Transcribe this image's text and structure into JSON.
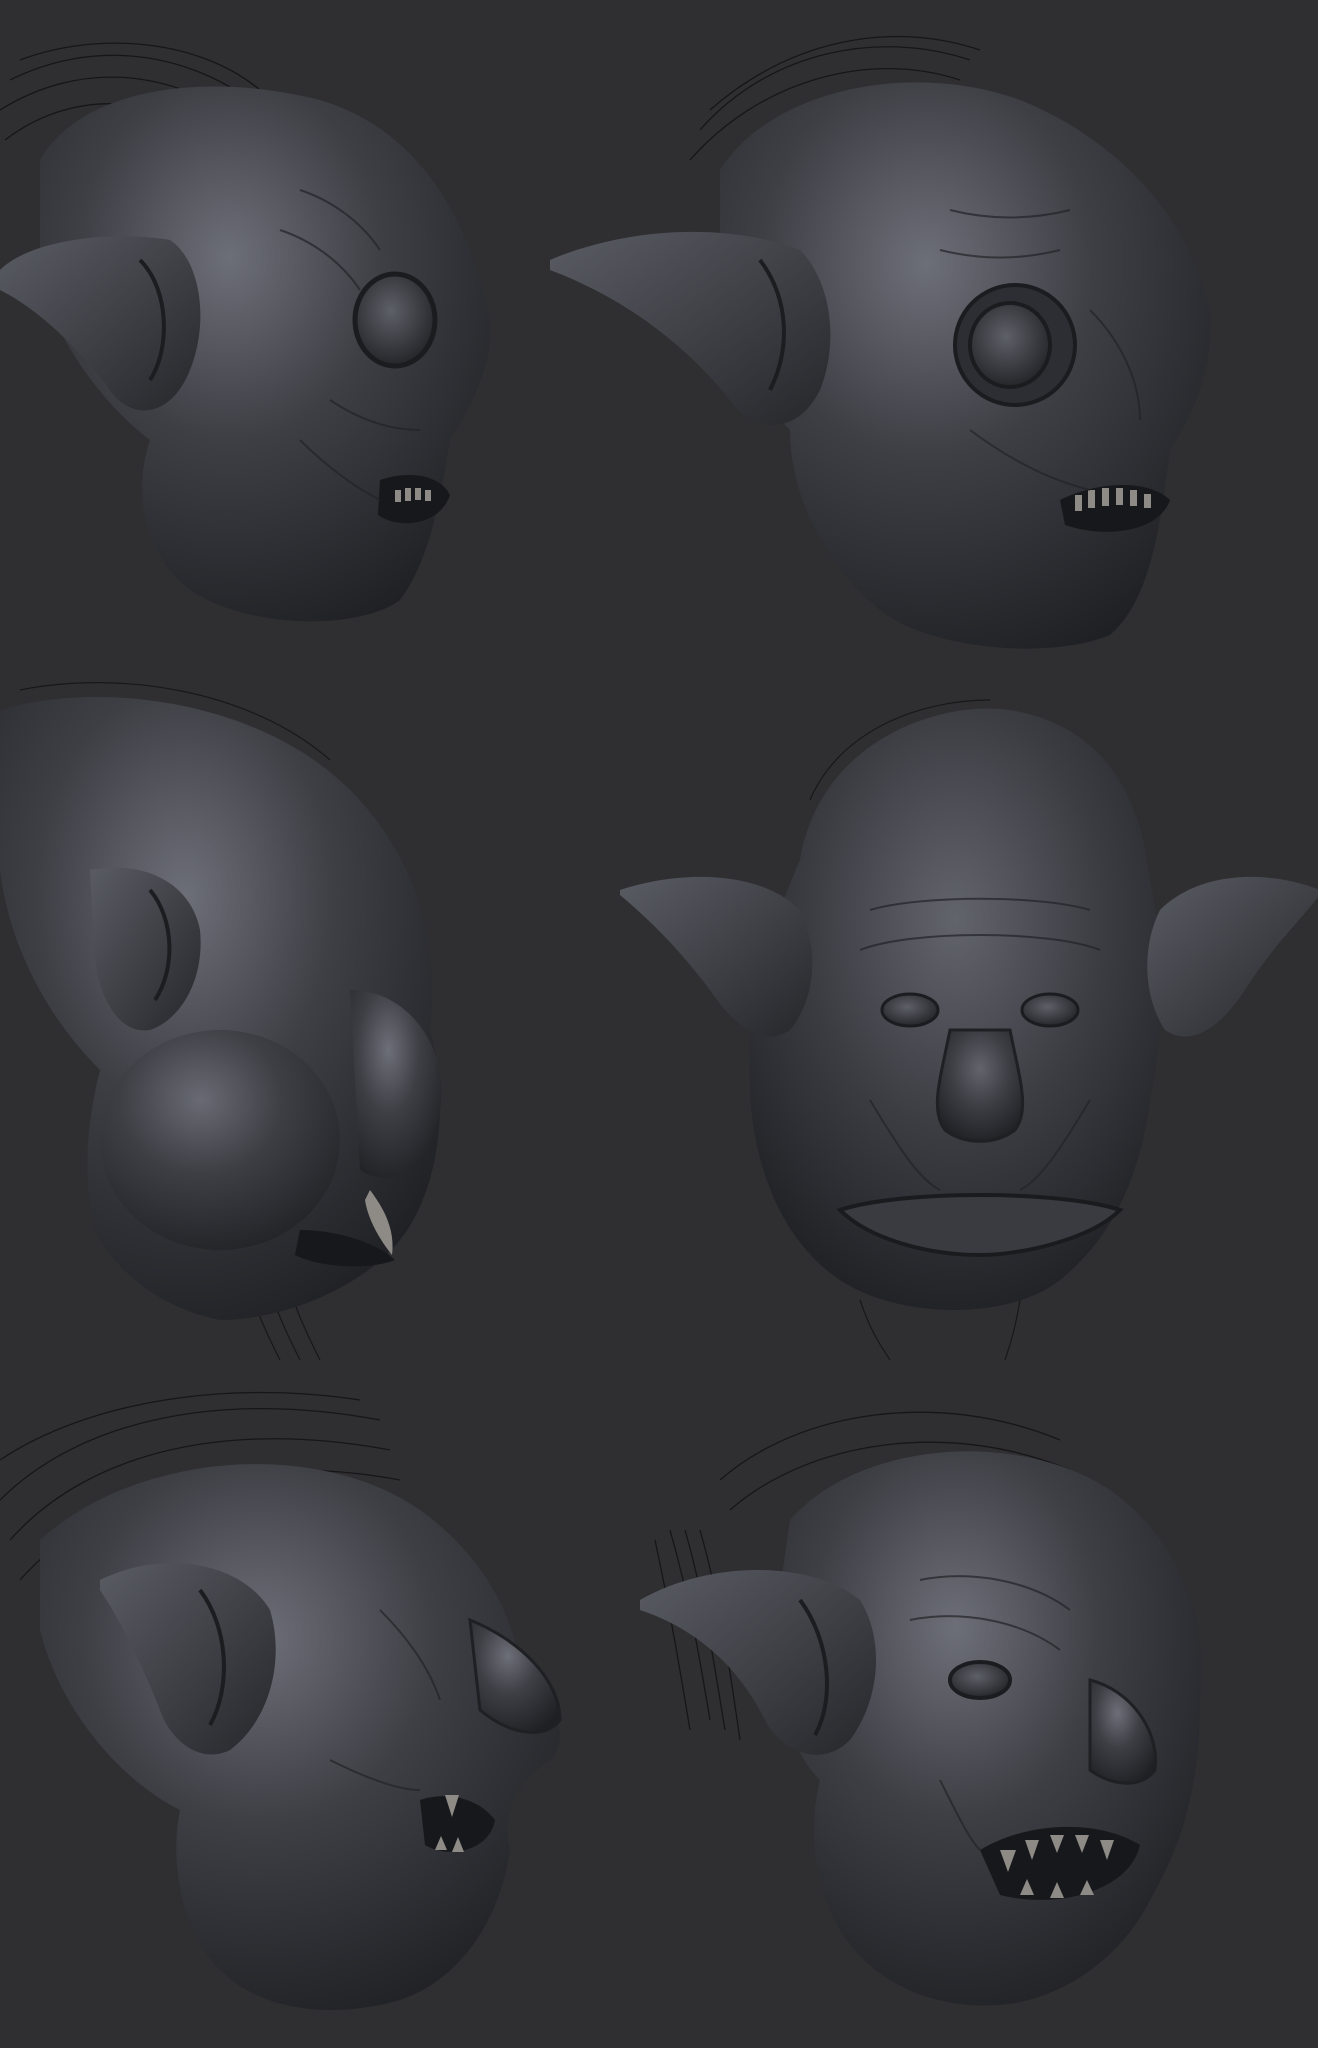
{
  "scene": {
    "background": "#2f2f31",
    "material_base": "#3b3c41",
    "material_dark": "#1f2024",
    "material_light": "#6d6f78",
    "hair_color": "#141416",
    "teeth_color": "#8e8b86"
  },
  "heads": [
    {
      "view": "three-quarter-left",
      "features": [
        "pointed-ear",
        "bulging-eye",
        "open-mouth",
        "hair-strands"
      ]
    },
    {
      "view": "three-quarter-right",
      "features": [
        "pointed-ear",
        "bulging-eye",
        "open-mouth",
        "hair-strands"
      ]
    },
    {
      "view": "profile-right",
      "features": [
        "ear",
        "swollen-cheek",
        "tusk",
        "hair-strands"
      ]
    },
    {
      "view": "front",
      "features": [
        "two-pointed-ears",
        "flat-nose",
        "thick-lips",
        "hair-strands"
      ]
    },
    {
      "view": "profile-right",
      "features": [
        "pointed-ear",
        "hooked-nose",
        "open-mouth",
        "hair-strands"
      ]
    },
    {
      "view": "three-quarter-right",
      "features": [
        "pointed-ear",
        "snarl",
        "open-mouth",
        "hair-strands"
      ]
    }
  ]
}
